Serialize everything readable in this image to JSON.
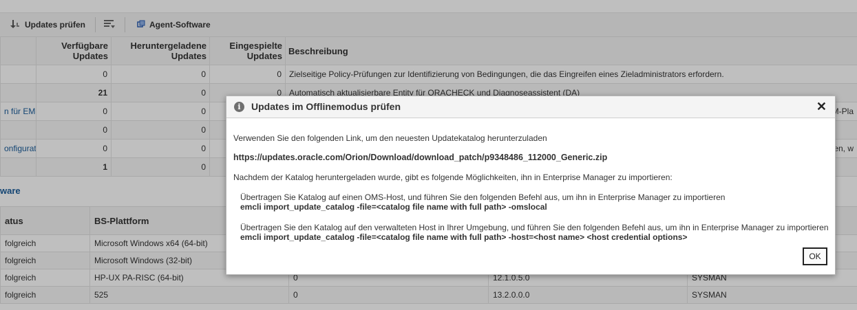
{
  "toolbar": {
    "check_updates_label": "Updates prüfen",
    "agent_software_label": "Agent-Software"
  },
  "updates_table": {
    "headers": {
      "available": [
        "Verfügbare",
        "Updates"
      ],
      "downloaded": [
        "Heruntergeladene",
        "Updates"
      ],
      "applied": [
        "Eingespielte",
        "Updates"
      ],
      "description": "Beschreibung"
    },
    "rows": [
      {
        "name": "",
        "available": "0",
        "downloaded": "0",
        "applied": "0",
        "description": "Zielseitige Policy-Prüfungen zur Identifizierung von Bedingungen, die das Eingreifen eines Zieladministrators erfordern."
      },
      {
        "name": "",
        "available": "21",
        "downloaded": "0",
        "applied": "0",
        "description": "Automatisch aktualisierbare Entity für ORACHECK und Diagnoseassistent (DA)"
      },
      {
        "name": "n für EM-D",
        "available": "0",
        "downloaded": "0",
        "applied": "",
        "description": ""
      },
      {
        "name": "",
        "available": "0",
        "downloaded": "0",
        "applied": "",
        "description": ""
      },
      {
        "name": "onfiguratio",
        "available": "0",
        "downloaded": "0",
        "applied": "",
        "description": ""
      },
      {
        "name": "",
        "available": "1",
        "downloaded": "0",
        "applied": "",
        "description": ""
      }
    ],
    "right_edge_fragments": [
      "EM-Pla",
      "hen, w"
    ]
  },
  "agent_section": {
    "title": "ware",
    "headers": {
      "status": "atus",
      "platform": "BS-Plattform"
    },
    "rows": [
      {
        "status": "folgreich",
        "platform": "Microsoft Windows x64 (64-bit)",
        "c3": "",
        "c4": "",
        "c5": ""
      },
      {
        "status": "folgreich",
        "platform": "Microsoft Windows (32-bit)",
        "c3": "",
        "c4": "",
        "c5": ""
      },
      {
        "status": "folgreich",
        "platform": "HP-UX PA-RISC (64-bit)",
        "c3": "0",
        "c4": "12.1.0.5.0",
        "c5": "SYSMAN"
      },
      {
        "status": "folgreich",
        "platform": "525",
        "c3": "0",
        "c4": "13.2.0.0.0",
        "c5": "SYSMAN"
      }
    ]
  },
  "dialog": {
    "title": "Updates im Offlinemodus prüfen",
    "intro": "Verwenden Sie den folgenden Link, um den neuesten Updatekatalog herunterzuladen",
    "link": "https://updates.oracle.com/Orion/Download/download_patch/p9348486_112000_Generic.zip",
    "after_download": "Nachdem der Katalog heruntergeladen wurde, gibt es folgende Möglichkeiten, ihn in Enterprise Manager zu importieren:",
    "option1_text": "Übertragen Sie Katalog auf einen OMS-Host, und führen Sie den folgenden Befehl aus, um ihn in Enterprise Manager zu importieren",
    "option1_cmd": "emcli import_update_catalog -file=<catalog file name with full path> -omslocal",
    "option2_text": "Übertragen Sie den Katalog auf den verwalteten Host in Ihrer Umgebung, und führen Sie den folgenden Befehl aus, um ihn in Enterprise Manager zu importieren",
    "option2_cmd": "emcli import_update_catalog -file=<catalog file name with full path> -host=<host name> <host credential options>",
    "ok_label": "OK"
  },
  "icons": {
    "check_updates": "download-arrows-icon",
    "settings": "list-settings-icon",
    "agent_software": "agent-software-icon",
    "info": "info-icon",
    "close": "close-icon"
  },
  "colors": {
    "link": "#1a5c9a",
    "overlay": "rgba(0,0,0,0.25)"
  }
}
